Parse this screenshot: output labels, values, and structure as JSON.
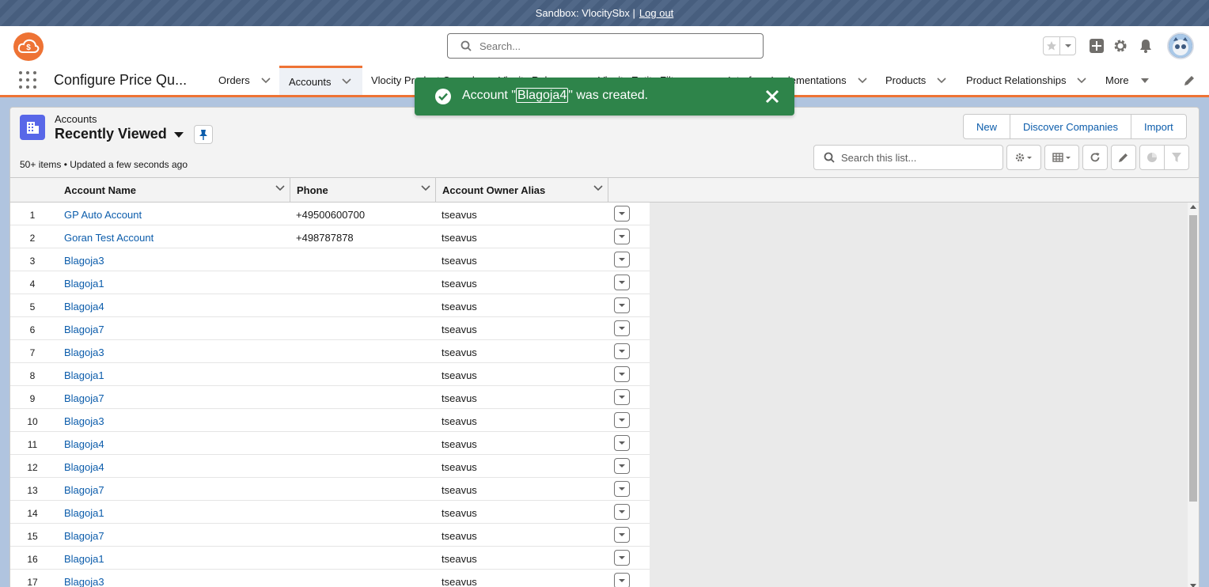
{
  "sandbox": {
    "label": "Sandbox: VlocitySbx |",
    "logout": "Log out"
  },
  "header": {
    "search_placeholder": "Search...",
    "app_name": "Configure Price Qu..."
  },
  "nav": {
    "items": [
      {
        "label": "Orders"
      },
      {
        "label": "Accounts"
      },
      {
        "label": "Vlocity Product Console"
      },
      {
        "label": "Vlocity Rules"
      },
      {
        "label": "Vlocity Entity Filters"
      },
      {
        "label": "Interface Implementations"
      },
      {
        "label": "Products"
      },
      {
        "label": "Product Relationships"
      },
      {
        "label": "More"
      }
    ]
  },
  "toast": {
    "prefix": "Account \"",
    "record": "Blagoja4",
    "suffix": "\" was created."
  },
  "list": {
    "object_label": "Accounts",
    "view_name": "Recently Viewed",
    "meta": "50+ items • Updated a few seconds ago",
    "buttons": {
      "new": "New",
      "discover": "Discover Companies",
      "import": "Import"
    },
    "search_placeholder": "Search this list..."
  },
  "table": {
    "columns": {
      "name": "Account Name",
      "phone": "Phone",
      "owner": "Account Owner Alias"
    },
    "rows": [
      {
        "num": "1",
        "name": "GP Auto Account",
        "phone": "+49500600700",
        "owner": "tseavus"
      },
      {
        "num": "2",
        "name": "Goran Test Account",
        "phone": "+498787878",
        "owner": "tseavus"
      },
      {
        "num": "3",
        "name": "Blagoja3",
        "phone": "",
        "owner": "tseavus"
      },
      {
        "num": "4",
        "name": "Blagoja1",
        "phone": "",
        "owner": "tseavus"
      },
      {
        "num": "5",
        "name": "Blagoja4",
        "phone": "",
        "owner": "tseavus"
      },
      {
        "num": "6",
        "name": "Blagoja7",
        "phone": "",
        "owner": "tseavus"
      },
      {
        "num": "7",
        "name": "Blagoja3",
        "phone": "",
        "owner": "tseavus"
      },
      {
        "num": "8",
        "name": "Blagoja1",
        "phone": "",
        "owner": "tseavus"
      },
      {
        "num": "9",
        "name": "Blagoja7",
        "phone": "",
        "owner": "tseavus"
      },
      {
        "num": "10",
        "name": "Blagoja3",
        "phone": "",
        "owner": "tseavus"
      },
      {
        "num": "11",
        "name": "Blagoja4",
        "phone": "",
        "owner": "tseavus"
      },
      {
        "num": "12",
        "name": "Blagoja4",
        "phone": "",
        "owner": "tseavus"
      },
      {
        "num": "13",
        "name": "Blagoja7",
        "phone": "",
        "owner": "tseavus"
      },
      {
        "num": "14",
        "name": "Blagoja1",
        "phone": "",
        "owner": "tseavus"
      },
      {
        "num": "15",
        "name": "Blagoja7",
        "phone": "",
        "owner": "tseavus"
      },
      {
        "num": "16",
        "name": "Blagoja1",
        "phone": "",
        "owner": "tseavus"
      },
      {
        "num": "17",
        "name": "Blagoja3",
        "phone": "",
        "owner": "tseavus"
      }
    ]
  },
  "colors": {
    "accent": "#ee7335",
    "link": "#0b5cab",
    "toast": "#2e844a",
    "object_icon": "#5867e8"
  }
}
